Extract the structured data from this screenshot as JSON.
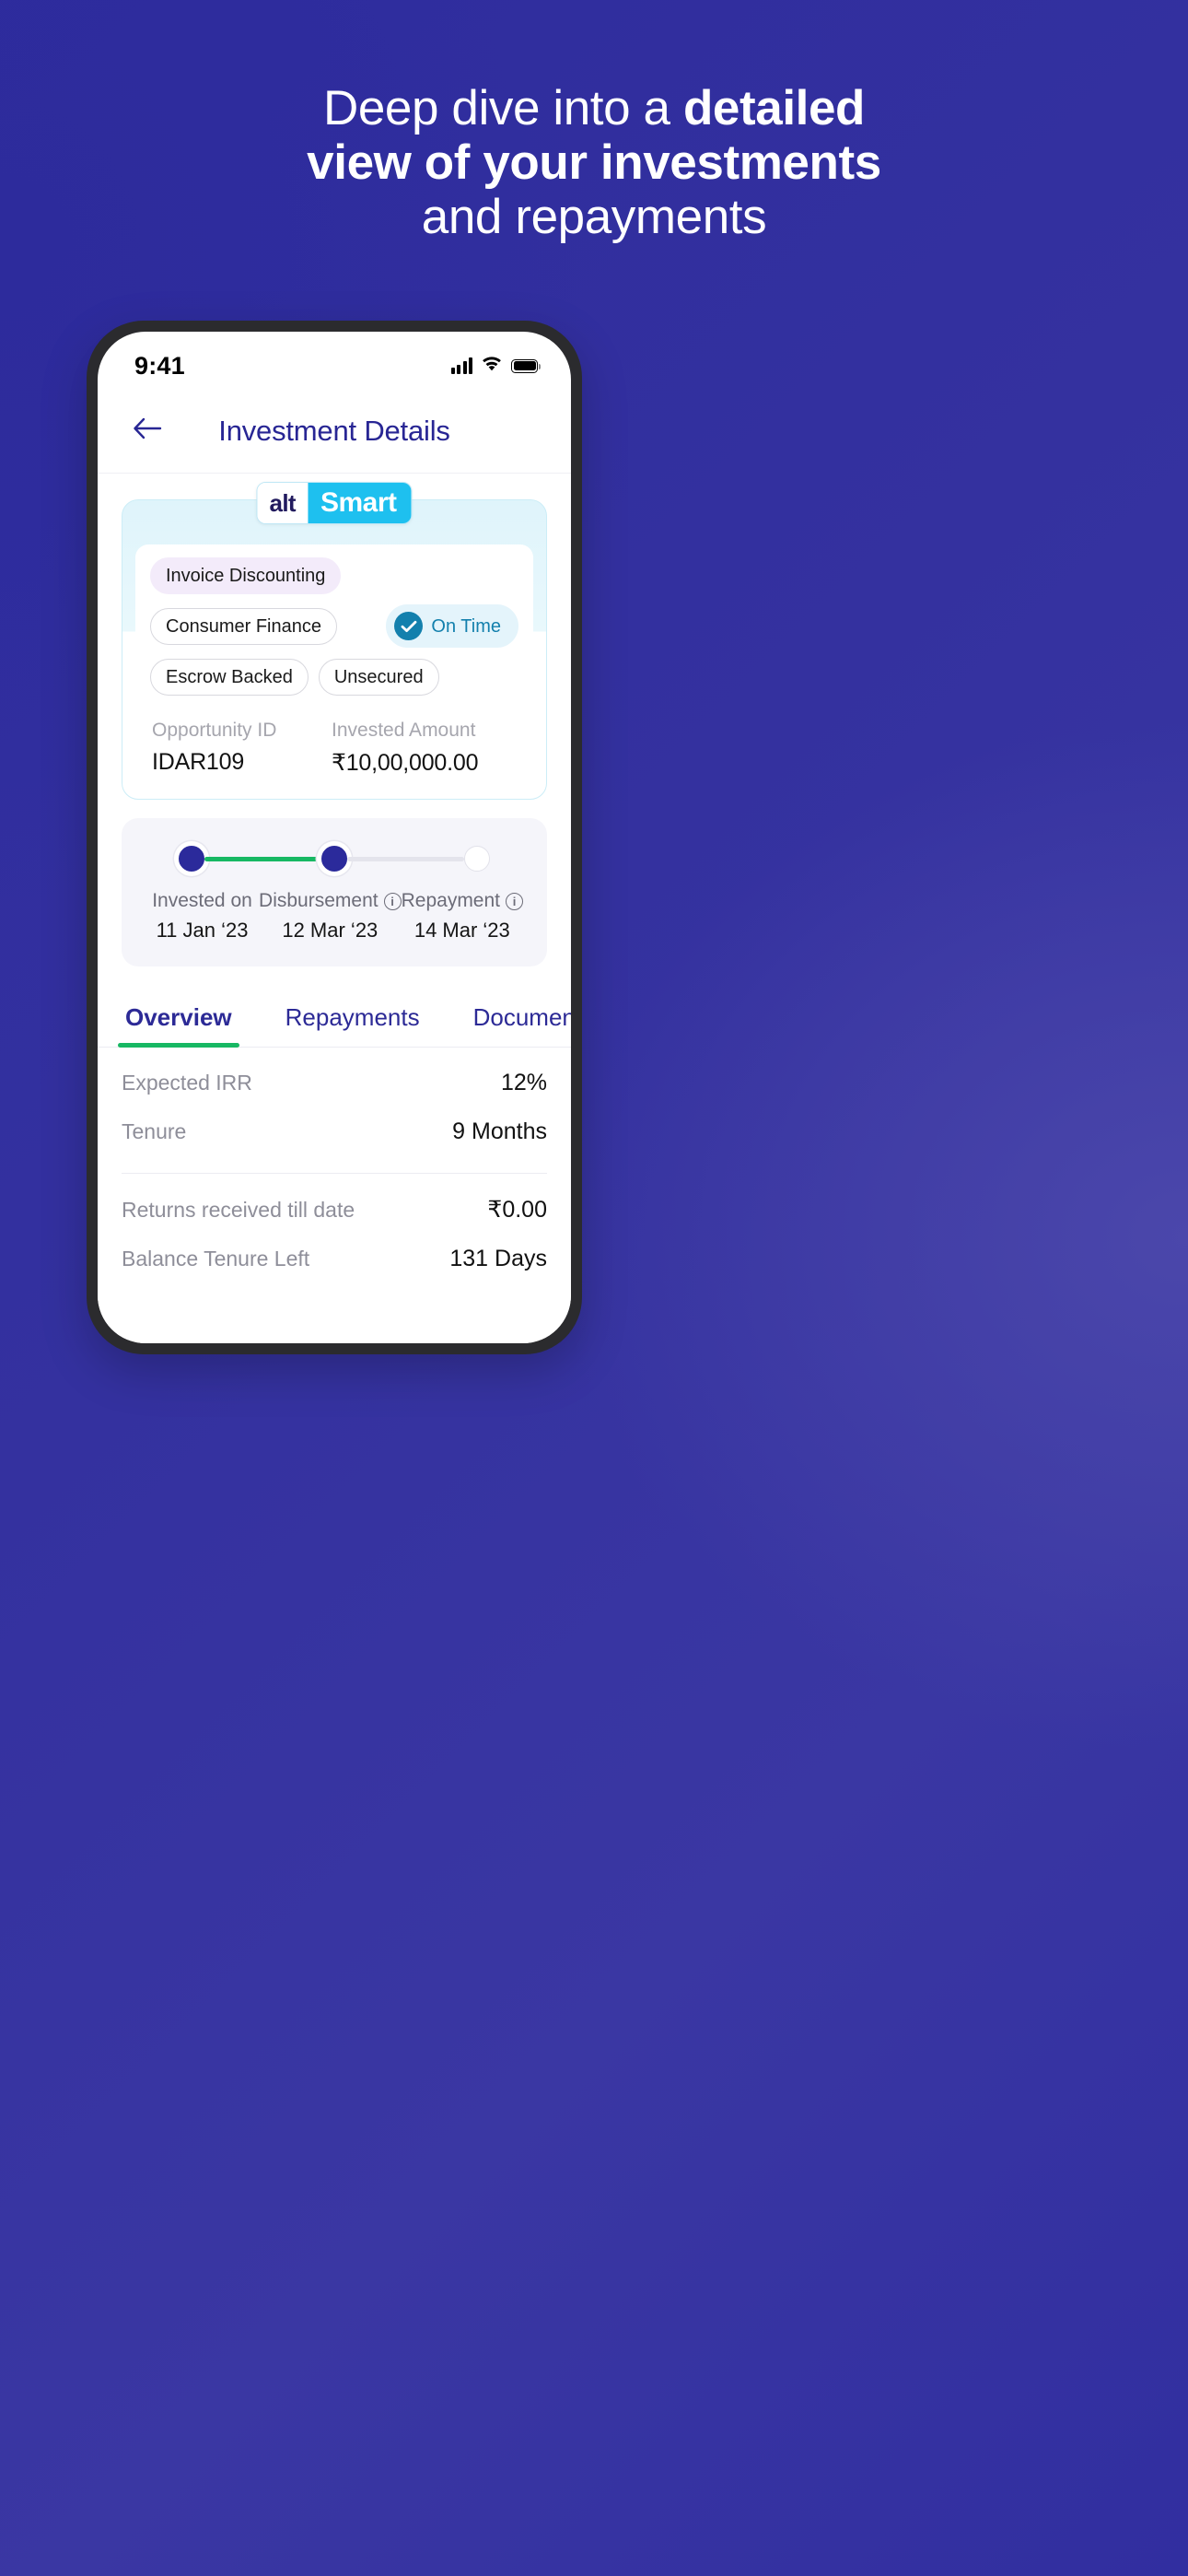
{
  "promo": {
    "headline_lines": [
      {
        "plain": "Deep dive into a ",
        "bold": "detailed"
      },
      {
        "plain": "",
        "bold": "view of your investments"
      },
      {
        "plain": "and repayments",
        "bold": ""
      }
    ],
    "line1_plain": "Deep dive into a ",
    "line1_bold": "detailed",
    "line2_bold": "view of your investments",
    "line3_plain": "and repayments"
  },
  "status_bar": {
    "time": "9:41",
    "signal_icon": "cellular-signal-icon",
    "wifi_icon": "wifi-icon",
    "battery_icon": "battery-icon"
  },
  "nav": {
    "back_icon": "back-arrow-icon",
    "title": "Investment Details"
  },
  "summary_card": {
    "logo_left": "alt",
    "logo_right": "Smart",
    "chips": [
      {
        "label": "Invoice Discounting",
        "style": "lilac"
      },
      {
        "label": "Consumer Finance",
        "style": "outline"
      },
      {
        "label": "Escrow Backed",
        "style": "outline"
      },
      {
        "label": "Unsecured",
        "style": "outline"
      }
    ],
    "status_badge": {
      "label": "On Time",
      "icon": "check-circle-icon",
      "color": "#1380ad"
    },
    "fields": [
      {
        "label": "Opportunity ID",
        "value": "IDAR109"
      },
      {
        "label": "Invested Amount",
        "value": "₹10,00,000.00"
      }
    ]
  },
  "timeline": {
    "steps": [
      {
        "label": "Invested on",
        "date": "11 Jan ‘23",
        "state": "complete",
        "has_info": false
      },
      {
        "label": "Disbursement",
        "date": "12 Mar ‘23",
        "state": "complete",
        "has_info": true
      },
      {
        "label": "Repayment",
        "date": "14 Mar ‘23",
        "state": "pending",
        "has_info": true
      }
    ],
    "info_icon": "info-icon",
    "progress_color": "#17b863"
  },
  "tabs": [
    {
      "label": "Overview",
      "active": true
    },
    {
      "label": "Repayments",
      "active": false
    },
    {
      "label": "Documents",
      "active": false
    }
  ],
  "overview": {
    "group1": [
      {
        "label": "Expected IRR",
        "value": "12%"
      },
      {
        "label": "Tenure",
        "value": "9 Months"
      }
    ],
    "group2": [
      {
        "label": "Returns received till date",
        "value": "₹0.00"
      },
      {
        "label": "Balance Tenure Left",
        "value": "131 Days"
      }
    ]
  },
  "theme": {
    "background_indigo": "#2E2D9E",
    "brand_navy": "#282694",
    "brand_cyan": "#1EC0EF",
    "accent_green": "#17B863",
    "status_teal": "#1380AD",
    "chip_lilac": "#F3EBFA"
  }
}
